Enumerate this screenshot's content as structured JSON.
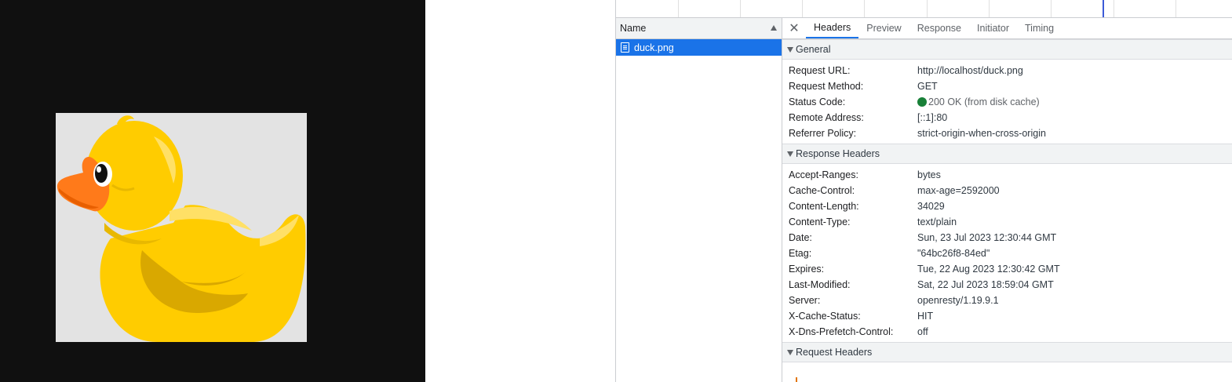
{
  "preview": {
    "image_alt": "Yellow rubber duck",
    "background": "#101010"
  },
  "network": {
    "name_column": "Name",
    "requests": [
      {
        "name": "duck.png",
        "selected": true
      }
    ]
  },
  "tabs": {
    "close_icon": "close-icon",
    "items": [
      "Headers",
      "Preview",
      "Response",
      "Initiator",
      "Timing"
    ],
    "active": "Headers"
  },
  "general": {
    "title": "General",
    "rows": [
      {
        "key": "Request URL:",
        "value": "http://localhost/duck.png"
      },
      {
        "key": "Request Method:",
        "value": "GET"
      },
      {
        "key": "Status Code:",
        "value": "200 OK (from disk cache)"
      },
      {
        "key": "Remote Address:",
        "value": "[::1]:80"
      },
      {
        "key": "Referrer Policy:",
        "value": "strict-origin-when-cross-origin"
      }
    ]
  },
  "response_headers": {
    "title": "Response Headers",
    "rows": [
      {
        "key": "Accept-Ranges:",
        "value": "bytes"
      },
      {
        "key": "Cache-Control:",
        "value": "max-age=2592000"
      },
      {
        "key": "Content-Length:",
        "value": "34029"
      },
      {
        "key": "Content-Type:",
        "value": "text/plain"
      },
      {
        "key": "Date:",
        "value": "Sun, 23 Jul 2023 12:30:44 GMT"
      },
      {
        "key": "Etag:",
        "value": "\"64bc26f8-84ed\""
      },
      {
        "key": "Expires:",
        "value": "Tue, 22 Aug 2023 12:30:42 GMT"
      },
      {
        "key": "Last-Modified:",
        "value": "Sat, 22 Jul 2023 18:59:04 GMT"
      },
      {
        "key": "Server:",
        "value": "openresty/1.19.9.1"
      },
      {
        "key": "X-Cache-Status:",
        "value": "HIT"
      },
      {
        "key": "X-Dns-Prefetch-Control:",
        "value": "off"
      }
    ]
  },
  "request_headers": {
    "title": "Request Headers"
  },
  "colors": {
    "accent": "#1a73e8",
    "status_ok": "#188038",
    "duck_yellow": "#ffcc00",
    "duck_beak": "#ff7a1a"
  }
}
